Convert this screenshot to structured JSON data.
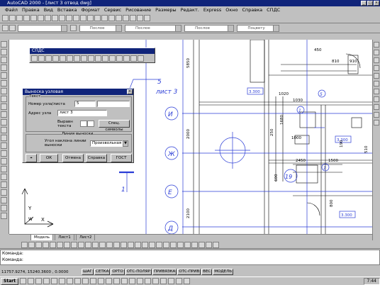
{
  "window": {
    "title": "AutoCAD 2000 - [лист 3 отвод dwg]"
  },
  "menu": [
    "Файл",
    "Правка",
    "Вид",
    "Вставка",
    "Формат",
    "Сервис",
    "Рисование",
    "Размеры",
    "Редакт.",
    "Express",
    "Окно",
    "Справка",
    "СПДС"
  ],
  "toolbar": {
    "layer_combo": "Послое",
    "lineweight_combo": "Послое",
    "color_combo": "Послое",
    "plot_combo": "Поцвету"
  },
  "spds_panel": {
    "title": "СПДС"
  },
  "dialog": {
    "title": "Выноска узловая",
    "group_text": "Текст",
    "node_label": "Номер узла/листа",
    "node_value": "5",
    "address_label": "Адрес узла",
    "address_value": "лист 3",
    "align_label": "Выравн текста",
    "special_symbols": "Спец. символы",
    "group_line": "Линия выноски",
    "angle_label": "Угол наклона линии выноски",
    "angle_value": "Произвольная",
    "ok": "ОК",
    "cancel": "Отмена",
    "help": "Справка",
    "gost": "ГОСТ"
  },
  "drawing": {
    "callout_number": "5",
    "callout_sheet": "лист 3",
    "section_mark": "1",
    "axes": [
      "И",
      "Ж",
      "Е",
      "Д"
    ],
    "dims": {
      "d5850": "5850",
      "d2000": "2000",
      "d2100": "2100",
      "d3300a": "3.300",
      "d3300b": "3.300",
      "d3300c": "3.300",
      "d250": "250",
      "d1000": "1000",
      "d2450": "2450",
      "d810": "810",
      "d910": "910",
      "d1030": "1030",
      "d1020": "1020",
      "d1500": "1500",
      "d190": "190",
      "d800": "800",
      "d600": "600",
      "d1680": "1680",
      "d450": "450",
      "d510": "510"
    },
    "circle_labels": [
      "19",
      "1",
      "5",
      "1"
    ],
    "numbers": [
      "2",
      "3",
      "4",
      "5",
      "6",
      "7"
    ]
  },
  "tabs": [
    "Модель",
    "Лист1",
    "Лист2"
  ],
  "command": {
    "line1": "Команда:",
    "line2": "Команда:"
  },
  "status": {
    "coords": "11757.9274, 15240.3600 , 0.0000",
    "buttons": [
      "ШАГ",
      "СЕТКА",
      "ОРТО",
      "ОТС-ПОЛЯР",
      "ПРИВЯЗКА",
      "ОТС-ПРИВ",
      "ВЕС",
      "МОДЕЛЬ"
    ]
  },
  "taskbar": {
    "start": "Start",
    "clock": "7:44"
  }
}
